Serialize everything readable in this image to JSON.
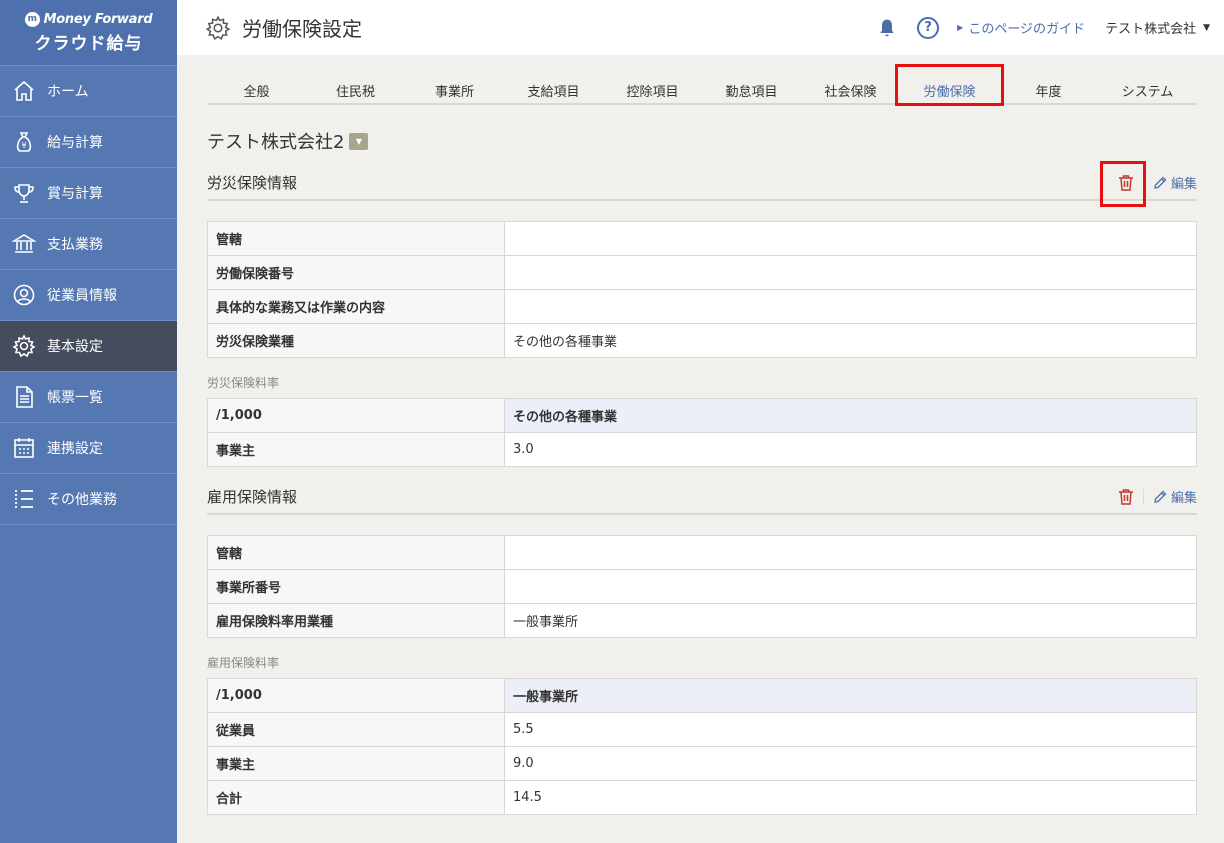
{
  "app": {
    "brand_top": "Money Forward",
    "brand_bottom": "クラウド給与",
    "page_title": "労働保険設定"
  },
  "sidebar": {
    "items": [
      {
        "label": "ホーム",
        "icon": "home-icon"
      },
      {
        "label": "給与計算",
        "icon": "money-bag-icon"
      },
      {
        "label": "賞与計算",
        "icon": "trophy-icon"
      },
      {
        "label": "支払業務",
        "icon": "bank-icon"
      },
      {
        "label": "従業員情報",
        "icon": "person-icon"
      },
      {
        "label": "基本設定",
        "icon": "gear-icon",
        "active": true
      },
      {
        "label": "帳票一覧",
        "icon": "document-icon"
      },
      {
        "label": "連携設定",
        "icon": "calendar-icon"
      },
      {
        "label": "その他業務",
        "icon": "list-icon"
      }
    ]
  },
  "header": {
    "guide": "このページのガイド",
    "company": "テスト株式会社"
  },
  "tabs": [
    {
      "label": "全般"
    },
    {
      "label": "住民税"
    },
    {
      "label": "事業所"
    },
    {
      "label": "支給項目"
    },
    {
      "label": "控除項目"
    },
    {
      "label": "勤怠項目"
    },
    {
      "label": "社会保険"
    },
    {
      "label": "労働保険",
      "active": true
    },
    {
      "label": "年度"
    },
    {
      "label": "システム"
    }
  ],
  "company_name": "テスト株式会社2",
  "edit_label": "編集",
  "rosai": {
    "title": "労災保険情報",
    "rows": [
      {
        "key": "管轄",
        "value": ""
      },
      {
        "key": "労働保険番号",
        "value": ""
      },
      {
        "key": "具体的な業務又は作業の内容",
        "value": ""
      },
      {
        "key": "労災保険業種",
        "value": "その他の各種事業"
      }
    ],
    "rate_label": "労災保険料率",
    "rate_header": {
      "key": "/1,000",
      "value": "その他の各種事業"
    },
    "rate_rows": [
      {
        "key": "事業主",
        "value": "3.0"
      }
    ]
  },
  "koyo": {
    "title": "雇用保険情報",
    "rows": [
      {
        "key": "管轄",
        "value": ""
      },
      {
        "key": "事業所番号",
        "value": ""
      },
      {
        "key": "雇用保険料率用業種",
        "value": "一般事業所"
      }
    ],
    "rate_label": "雇用保険料率",
    "rate_header": {
      "key": "/1,000",
      "value": "一般事業所"
    },
    "rate_rows": [
      {
        "key": "従業員",
        "value": "5.5"
      },
      {
        "key": "事業主",
        "value": "9.0"
      },
      {
        "key": "合計",
        "value": "14.5"
      }
    ]
  },
  "colors": {
    "sidebar": "#5578b3",
    "sidebar_active": "#454c5d",
    "link": "#4a6ea9",
    "highlight": "#e8100f",
    "trash": "#c0392b"
  }
}
